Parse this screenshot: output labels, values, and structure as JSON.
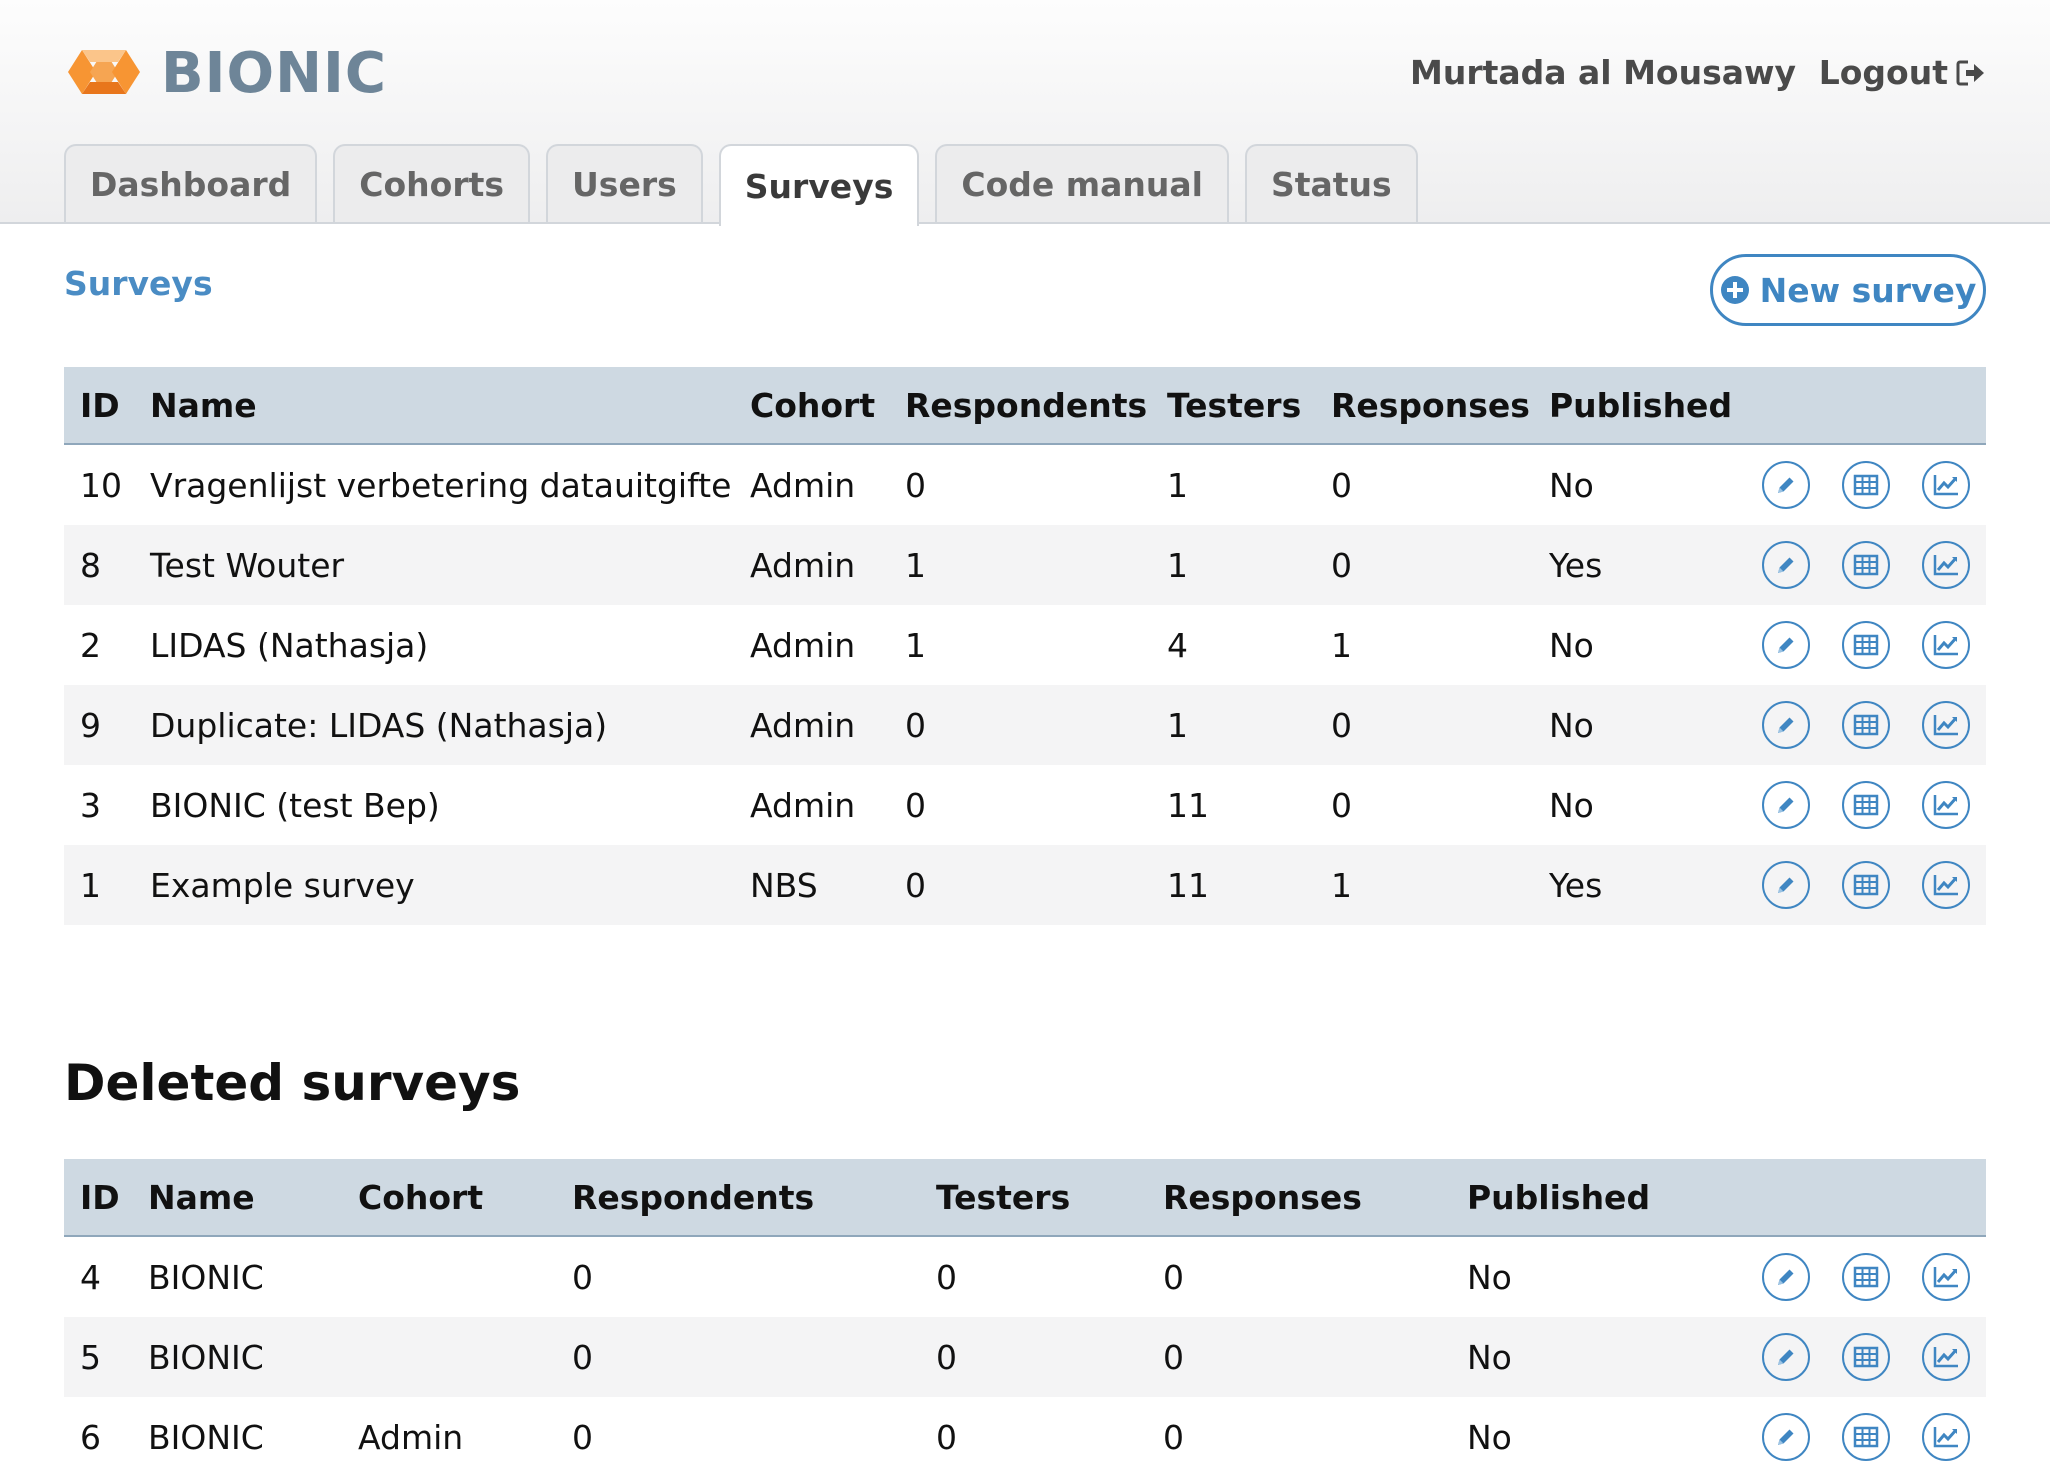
{
  "header": {
    "brand": "BIONIC",
    "user_name": "Murtada al Mousawy",
    "logout_label": "Logout"
  },
  "tabs": [
    {
      "label": "Dashboard"
    },
    {
      "label": "Cohorts"
    },
    {
      "label": "Users"
    },
    {
      "label": "Surveys",
      "active": true
    },
    {
      "label": "Code manual"
    },
    {
      "label": "Status"
    }
  ],
  "breadcrumb": "Surveys",
  "new_survey_label": "New survey",
  "columns": {
    "id": "ID",
    "name": "Name",
    "cohort": "Cohort",
    "respondents": "Respondents",
    "testers": "Testers",
    "responses": "Responses",
    "published": "Published"
  },
  "surveys": [
    {
      "id": "10",
      "name": "Vragenlijst verbetering datauitgifte",
      "cohort": "Admin",
      "respondents": "0",
      "testers": "1",
      "responses": "0",
      "published": "No"
    },
    {
      "id": "8",
      "name": "Test Wouter",
      "cohort": "Admin",
      "respondents": "1",
      "testers": "1",
      "responses": "0",
      "published": "Yes"
    },
    {
      "id": "2",
      "name": "LIDAS (Nathasja)",
      "cohort": "Admin",
      "respondents": "1",
      "testers": "4",
      "responses": "1",
      "published": "No"
    },
    {
      "id": "9",
      "name": "Duplicate: LIDAS (Nathasja)",
      "cohort": "Admin",
      "respondents": "0",
      "testers": "1",
      "responses": "0",
      "published": "No"
    },
    {
      "id": "3",
      "name": "BIONIC (test Bep)",
      "cohort": "Admin",
      "respondents": "0",
      "testers": "11",
      "responses": "0",
      "published": "No"
    },
    {
      "id": "1",
      "name": "Example survey",
      "cohort": "NBS",
      "respondents": "0",
      "testers": "11",
      "responses": "1",
      "published": "Yes"
    }
  ],
  "deleted_title": "Deleted surveys",
  "deleted_surveys": [
    {
      "id": "4",
      "name": "BIONIC",
      "cohort": "",
      "respondents": "0",
      "testers": "0",
      "responses": "0",
      "published": "No"
    },
    {
      "id": "5",
      "name": "BIONIC",
      "cohort": "",
      "respondents": "0",
      "testers": "0",
      "responses": "0",
      "published": "No"
    },
    {
      "id": "6",
      "name": "BIONIC",
      "cohort": "Admin",
      "respondents": "0",
      "testers": "0",
      "responses": "0",
      "published": "No"
    }
  ],
  "row_actions": [
    "edit-icon",
    "table-icon",
    "chart-icon"
  ],
  "colors": {
    "accent": "#3f86c2",
    "brand": "#6e8598",
    "logo_orange": "#f79533"
  }
}
